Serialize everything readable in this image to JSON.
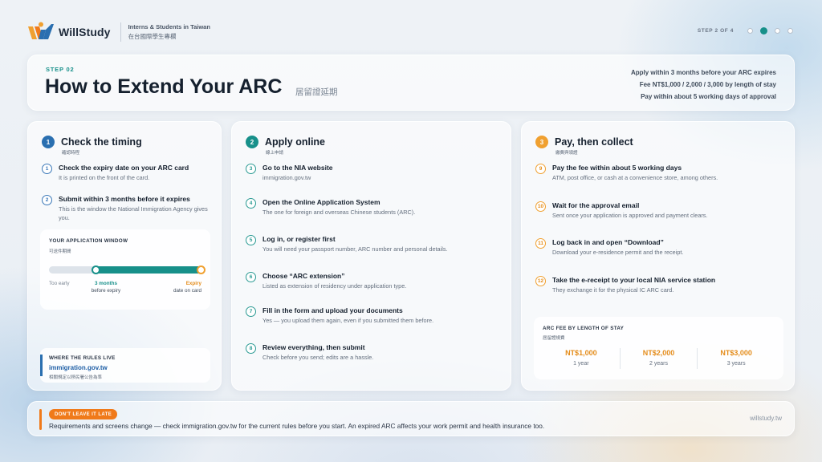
{
  "brand": {
    "name": "WillStudy",
    "tagline": "Interns & Students in Taiwan",
    "tagline_zh": "在台國際學生專欄",
    "colors": {
      "teal": "#17908a",
      "orange": "#f07a1a",
      "blue": "#2a6fb0"
    }
  },
  "step_indicator": {
    "label": "STEP 2 OF 4",
    "total": 4,
    "current": 2
  },
  "header": {
    "eyebrow": "STEP 02",
    "title": "How to Extend Your ARC",
    "title_zh": "居留證延期",
    "notes": [
      "Apply within 3 months before your ARC expires",
      "Fee NT$1,000 / 2,000 / 3,000 by length of stay",
      "Pay within about 5 working days of approval"
    ]
  },
  "columns": [
    {
      "number": "1",
      "title": "Check the timing",
      "title_zh": "確認時程",
      "items": [
        {
          "number": "1",
          "title": "Check the expiry date on your ARC card",
          "desc": "It is printed on the front of the card."
        },
        {
          "number": "2",
          "title": "Submit within 3 months before it expires",
          "desc": "This is the window the National Immigration Agency gives you."
        }
      ]
    },
    {
      "number": "2",
      "title": "Apply online",
      "title_zh": "線上申請",
      "items": [
        {
          "number": "3",
          "title": "Go to the NIA website",
          "desc": "immigration.gov.tw"
        },
        {
          "number": "4",
          "title": "Open the Online Application System",
          "desc": "The one for foreign and overseas Chinese students (ARC)."
        },
        {
          "number": "5",
          "title": "Log in, or register first",
          "desc": "You will need your passport number, ARC number and personal details."
        },
        {
          "number": "6",
          "title": "Choose “ARC extension”",
          "desc": "Listed as extension of residency under application type."
        },
        {
          "number": "7",
          "title": "Fill in the form and upload your documents",
          "desc": "Yes — you upload them again, even if you submitted them before."
        },
        {
          "number": "8",
          "title": "Review everything, then submit",
          "desc": "Check before you send; edits are a hassle."
        }
      ]
    },
    {
      "number": "3",
      "title": "Pay, then collect",
      "title_zh": "繳費與領證",
      "items": [
        {
          "number": "9",
          "title": "Pay the fee within about 5 working days",
          "desc": "ATM, post office, or cash at a convenience store, among others."
        },
        {
          "number": "10",
          "title": "Wait for the approval email",
          "desc": "Sent once your application is approved and payment clears."
        },
        {
          "number": "11",
          "title": "Log back in and open “Download”",
          "desc": "Download your e-residence permit and the receipt."
        },
        {
          "number": "12",
          "title": "Take the e-receipt to your local NIA service station",
          "desc": "They exchange it for the physical IC ARC card."
        }
      ]
    }
  ],
  "application_window": {
    "title": "YOUR APPLICATION WINDOW",
    "title_zh": "可送件期間",
    "too_early": "Too early",
    "window_label": "3 months",
    "window_sub": "before expiry",
    "expiry_label": "Expiry",
    "expiry_sub": "date on card"
  },
  "rules": {
    "title": "WHERE THE RULES LIVE",
    "link": "immigration.gov.tw",
    "note_zh": "相關規定以移民署公告為準"
  },
  "fees": {
    "title": "ARC FEE BY LENGTH OF STAY",
    "title_zh": "居留證規費",
    "rows": [
      {
        "amount": "NT$1,000",
        "length": "1 year"
      },
      {
        "amount": "NT$2,000",
        "length": "2 years"
      },
      {
        "amount": "NT$3,000",
        "length": "3 years"
      }
    ]
  },
  "footer": {
    "badge": "DON'T LEAVE IT LATE",
    "text": "Requirements and screens change — check immigration.gov.tw for the current rules before you start. An expired ARC affects your work permit and health insurance too.",
    "site": "willstudy.tw"
  }
}
